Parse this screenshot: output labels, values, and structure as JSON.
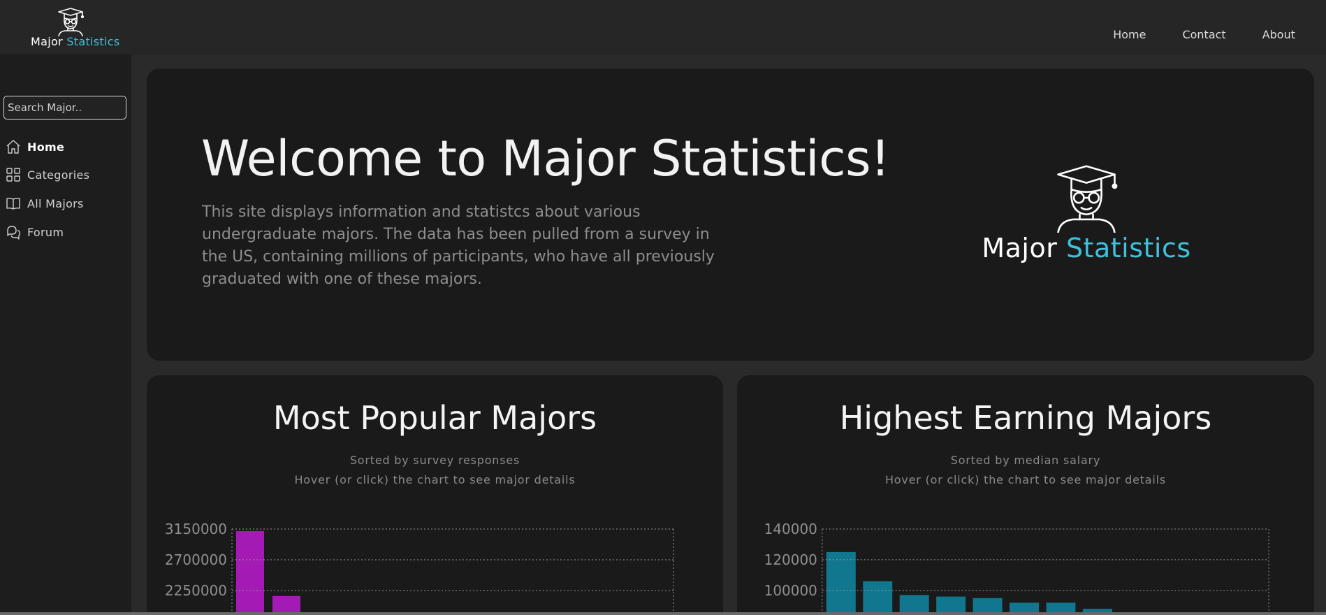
{
  "app": {
    "logo_word1": "Major",
    "logo_word2": "Statistics",
    "accent_color": "#3fc0dc"
  },
  "nav": {
    "home": "Home",
    "contact": "Contact",
    "about": "About"
  },
  "sidebar": {
    "search_placeholder": "Search Major..",
    "items": [
      {
        "label": "Home",
        "icon": "home-icon",
        "active": true
      },
      {
        "label": "Categories",
        "icon": "grid-icon",
        "active": false
      },
      {
        "label": "All Majors",
        "icon": "book-icon",
        "active": false
      },
      {
        "label": "Forum",
        "icon": "chat-icon",
        "active": false
      }
    ]
  },
  "hero": {
    "title": "Welcome to Major Statistics!",
    "description": "This site displays information and statistcs about various undergraduate majors. The data has been pulled from a survey in the US, containing millions of participants, who have all previously graduated with one of these majors.",
    "logo_word1": "Major",
    "logo_word2": "Statistics"
  },
  "cards": {
    "popular": {
      "title": "Most Popular Majors",
      "sub1": "Sorted by survey responses",
      "sub2": "Hover (or click) the chart to see major details"
    },
    "earning": {
      "title": "Highest Earning Majors",
      "sub1": "Sorted by median salary",
      "sub2": "Hover (or click) the chart to see major details"
    }
  },
  "chart_data": [
    {
      "type": "bar",
      "color": "#a31bb4",
      "y_ticks": [
        3150000,
        2700000,
        2250000
      ],
      "values": [
        3120000,
        2170000
      ],
      "grid": true
    },
    {
      "type": "bar",
      "color": "#11778f",
      "y_ticks": [
        140000,
        120000,
        100000
      ],
      "values": [
        125000,
        106000,
        97000,
        96000,
        95000,
        92000,
        92000,
        88000
      ],
      "grid": true
    }
  ]
}
